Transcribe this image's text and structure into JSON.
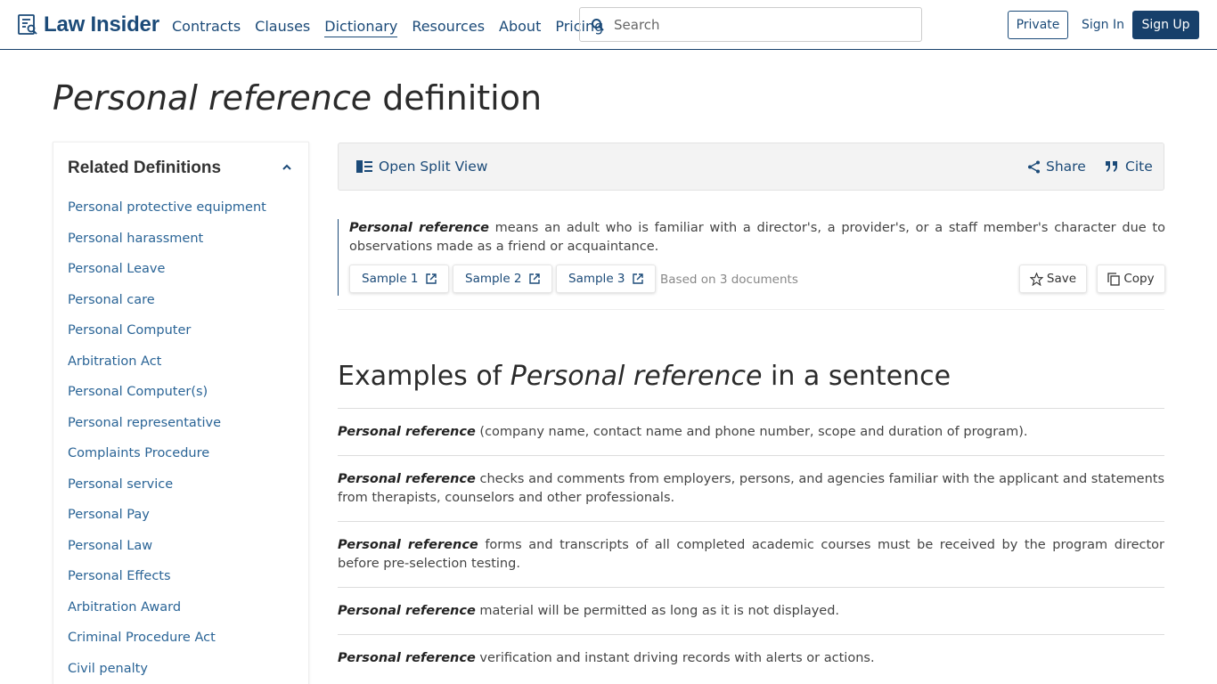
{
  "brand": {
    "name": "Law Insider"
  },
  "nav": {
    "items": [
      "Contracts",
      "Clauses",
      "Dictionary",
      "Resources",
      "About",
      "Pricing"
    ],
    "active": "Dictionary"
  },
  "search": {
    "placeholder": "Search"
  },
  "auth": {
    "private_label": "Private",
    "signin_label": "Sign In",
    "signup_label": "Sign Up"
  },
  "page": {
    "title_term": "Personal reference",
    "title_suffix": "definition"
  },
  "sidebar": {
    "title": "Related Definitions",
    "items": [
      "Personal protective equipment",
      "Personal harassment",
      "Personal Leave",
      "Personal care",
      "Personal Computer",
      "Arbitration Act",
      "Personal Computer(s)",
      "Personal representative",
      "Complaints Procedure",
      "Personal service",
      "Personal Pay",
      "Personal Law",
      "Personal Effects",
      "Arbitration Award",
      "Criminal Procedure Act",
      "Civil penalty"
    ]
  },
  "toolbar": {
    "split_label": "Open Split View",
    "share_label": "Share",
    "cite_label": "Cite"
  },
  "definition": {
    "term": "Personal reference",
    "text": " means an adult who is familiar with a director's, a provider's, or a staff member's character due to observations made as a friend or acquaintance.",
    "samples": [
      "Sample 1",
      "Sample 2",
      "Sample 3"
    ],
    "based_on": "Based on 3 documents",
    "save_label": "Save",
    "copy_label": "Copy"
  },
  "examples": {
    "title_prefix": "Examples of ",
    "title_term": "Personal reference",
    "title_suffix": " in a sentence",
    "items": [
      {
        "term": "Personal reference",
        "text": " (company name, contact name and phone number, scope and duration of program)."
      },
      {
        "term": "Personal reference",
        "text": " checks and comments from employers, persons, and agencies familiar with the applicant and statements from therapists, counselors and other professionals."
      },
      {
        "term": "Personal reference",
        "text": " forms and transcripts of all completed academic courses must be received by the program director before pre-selection testing."
      },
      {
        "term": "Personal reference",
        "text": " material will be permitted as long as it is not displayed."
      },
      {
        "term": "Personal reference",
        "text": " verification and instant driving records with alerts or actions."
      }
    ]
  }
}
